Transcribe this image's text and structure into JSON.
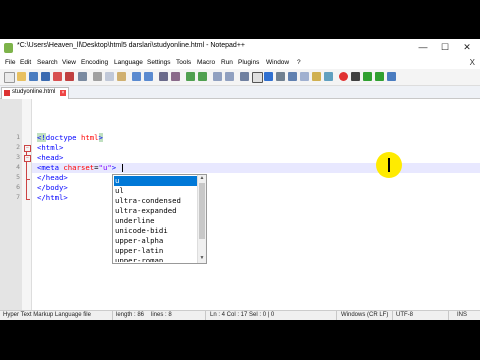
{
  "window": {
    "title": "*C:\\Users\\Heaven_ll\\Desktop\\html5 darslari\\studyonline.html - Notepad++",
    "minimize": "—",
    "maximize": "☐",
    "close": "✕"
  },
  "menu": [
    "File",
    "Edit",
    "Search",
    "View",
    "Encoding",
    "Language",
    "Settings",
    "Tools",
    "Macro",
    "Run",
    "Plugins",
    "Window",
    "?"
  ],
  "menu_close": "X",
  "toolbar_icons": [
    "new-file-icon",
    "open-file-icon",
    "save-icon",
    "save-all-icon",
    "close-icon",
    "close-all-icon",
    "print-icon",
    "cut-icon",
    "copy-icon",
    "paste-icon",
    "undo-icon",
    "redo-icon",
    "find-icon",
    "replace-icon",
    "zoom-in-icon",
    "zoom-out-icon",
    "sync-vertical-icon",
    "sync-horizontal-icon",
    "word-wrap-icon",
    "show-all-chars-icon",
    "indent-guide-icon",
    "udl-icon",
    "doc-map-icon",
    "function-list-icon",
    "folder-workspace-icon",
    "monitoring-icon",
    "record-macro-icon",
    "stop-macro-icon",
    "play-macro-icon",
    "run-macro-multiple-icon",
    "save-macro-icon"
  ],
  "tab": {
    "name": "studyonline.html"
  },
  "line_numbers": [
    "1",
    "2",
    "3",
    "4",
    "5",
    "6",
    "7"
  ],
  "code_lines": [
    {
      "open": "<!",
      "name": "doctype",
      "rest": " html",
      "close": ">"
    },
    {
      "open": "<",
      "name": "html",
      "close": ">"
    },
    {
      "open": "<",
      "name": "head",
      "close": ">"
    },
    {
      "open": "<",
      "name": "meta",
      "attr": " charset",
      "eq": "=",
      "str": "\"u\"",
      "close": ">"
    },
    {
      "open": "</",
      "name": "head",
      "close": ">"
    },
    {
      "open": "</",
      "name": "body",
      "close": ">"
    },
    {
      "open": "</",
      "name": "html",
      "close": ">"
    }
  ],
  "autocomplete": [
    "u",
    "ul",
    "ultra-condensed",
    "ultra-expanded",
    "underline",
    "unicode-bidi",
    "upper-alpha",
    "upper-latin",
    "upper-roman"
  ],
  "status": {
    "language": "Hyper Text Markup Language file",
    "length": "length : 86",
    "lines": "lines : 8",
    "position": "Ln : 4    Col : 17    Sel : 0 | 0",
    "eol": "Windows (CR LF)",
    "encoding": "UTF-8",
    "mode": "INS"
  },
  "colors": {
    "tag": "#0000ff",
    "attribute": "#ff0000",
    "string": "#8000ff",
    "selection": "#0078d7",
    "current_line": "#e8e8ff",
    "cursor_highlight": "#ffeb00"
  }
}
